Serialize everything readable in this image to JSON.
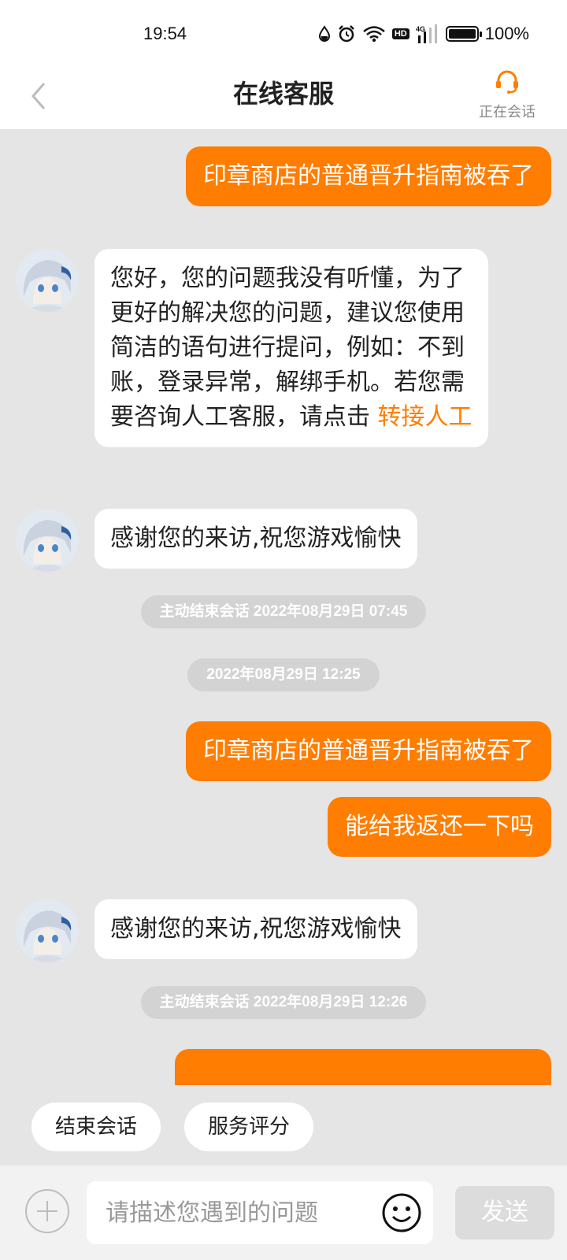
{
  "status_bar": {
    "time": "19:54",
    "battery": "100%",
    "icons": [
      "water-drop-icon",
      "alarm-icon",
      "wifi-icon",
      "hd-icon",
      "signal-4g-icon",
      "battery-icon"
    ],
    "hd_label": "HD",
    "network_label": "4G"
  },
  "header": {
    "title": "在线客服",
    "back_icon": "chevron-left-icon",
    "session_icon": "headset-icon",
    "session_status": "正在会话"
  },
  "colors": {
    "accent": "#ff7d00",
    "chat_background": "#e5e5e5",
    "timestamp_pill": "#d3d3d3"
  },
  "messages": {
    "m1": {
      "sender": "user",
      "text": "印章商店的普通晋升指南被吞了"
    },
    "m2": {
      "sender": "agent",
      "text": "您好，您的问题我没有听懂，为了更好的解决您的问题，建议您使用简洁的语句进行提问，例如：不到账，登录异常，解绑手机。若您需要咨询人工客服，请点击",
      "link": "转接人工"
    },
    "m3": {
      "sender": "agent",
      "text": "感谢您的来访,祝您游戏愉快"
    },
    "ts1": "主动结束会话 2022年08月29日 07:45",
    "ts2": "2022年08月29日 12:25",
    "m4": {
      "sender": "user",
      "text": "印章商店的普通晋升指南被吞了"
    },
    "m5": {
      "sender": "user",
      "text": "能给我返还一下吗"
    },
    "m6": {
      "sender": "agent",
      "text": "感谢您的来访,祝您游戏愉快"
    },
    "ts3": "主动结束会话 2022年08月29日 12:26"
  },
  "quick_actions": {
    "end_session": "结束会话",
    "rate_service": "服务评分"
  },
  "input": {
    "placeholder": "请描述您遇到的问题",
    "value": "",
    "send_label": "发送",
    "plus_icon": "plus-circle-icon",
    "emoji_icon": "smiley-icon"
  }
}
